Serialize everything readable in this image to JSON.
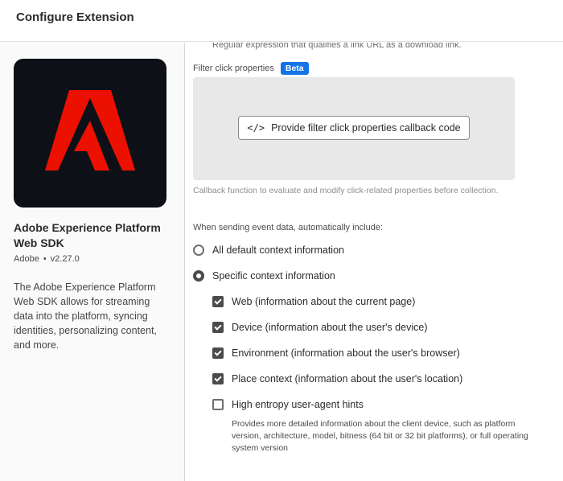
{
  "header": {
    "title": "Configure Extension"
  },
  "sidebar": {
    "extension_name": "Adobe Experience Platform Web SDK",
    "publisher": "Adobe",
    "version": "v2.27.0",
    "description": "The Adobe Experience Platform Web SDK allows for streaming data into the platform, syncing identities, personalizing content, and more.",
    "logo_icon": "adobe-logo-icon",
    "colors": {
      "logo_bg": "#0e1018",
      "logo_red": "#eb1000"
    }
  },
  "main": {
    "regex_help": "Regular expression that qualifies a link URL as a download link.",
    "filter_click": {
      "label": "Filter click properties",
      "badge": "Beta",
      "button_label": "Provide filter click properties callback code",
      "button_icon": "code-icon",
      "help": "Callback function to evaluate and modify click-related properties before collection."
    },
    "context": {
      "label": "When sending event data, automatically include:",
      "radios": [
        {
          "label": "All default context information",
          "checked": false
        },
        {
          "label": "Specific context information",
          "checked": true
        }
      ],
      "checkboxes": [
        {
          "label": "Web (information about the current page)",
          "checked": true
        },
        {
          "label": "Device (information about the user's device)",
          "checked": true
        },
        {
          "label": "Environment (information about the user's browser)",
          "checked": true
        },
        {
          "label": "Place context (information about the user's location)",
          "checked": true
        },
        {
          "label": "High entropy user-agent hints",
          "checked": false
        }
      ],
      "entropy_help": "Provides more detailed information about the client device, such as platform version, architecture, model, bitness (64 bit or 32 bit platforms), or full operating system version"
    },
    "colors": {
      "accent": "#1473e6",
      "control": "#4b4b4b"
    }
  }
}
